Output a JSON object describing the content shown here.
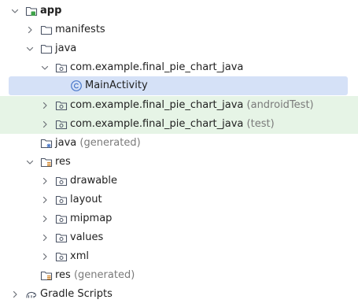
{
  "tree": {
    "app": {
      "label": "app"
    },
    "manifests": {
      "label": "manifests"
    },
    "java": {
      "label": "java"
    },
    "pkg_main": {
      "label": "com.example.final_pie_chart_java"
    },
    "main_activity": {
      "label": "MainActivity"
    },
    "pkg_android_test": {
      "label": "com.example.final_pie_chart_java",
      "suffix": "(androidTest)"
    },
    "pkg_test": {
      "label": "com.example.final_pie_chart_java",
      "suffix": "(test)"
    },
    "java_generated": {
      "label": "java",
      "suffix": "(generated)"
    },
    "res": {
      "label": "res"
    },
    "drawable": {
      "label": "drawable"
    },
    "layout": {
      "label": "layout"
    },
    "mipmap": {
      "label": "mipmap"
    },
    "values": {
      "label": "values"
    },
    "xml": {
      "label": "xml"
    },
    "res_generated": {
      "label": "res",
      "suffix": "(generated)"
    },
    "gradle_scripts": {
      "label": "Gradle Scripts"
    }
  },
  "colors": {
    "selected_row": "#d5e1f7",
    "test_row": "#e6f4e6",
    "folder_outline": "#4c5566",
    "module_accent": "#3fa34a",
    "class_icon": "#4a78c9",
    "suffix_text": "#7a7a7a"
  },
  "icons": {
    "expand": "chevron-down-icon",
    "collapse": "chevron-right-icon",
    "module": "module-folder-icon",
    "folder": "folder-icon",
    "package": "package-icon",
    "class": "class-icon",
    "generated_source": "generated-source-folder-icon",
    "resource": "resource-folder-icon",
    "gradle": "gradle-icon"
  }
}
